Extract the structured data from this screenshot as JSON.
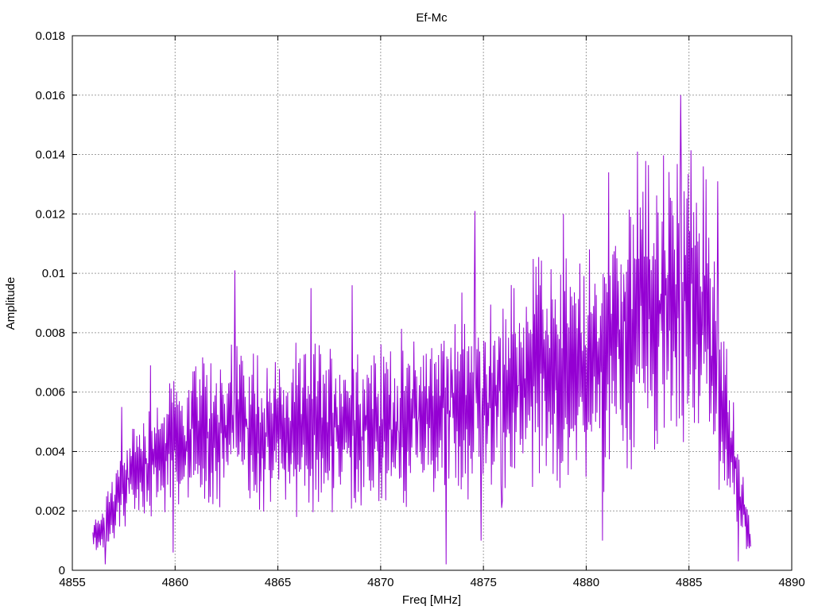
{
  "chart_data": {
    "type": "line",
    "title": "Ef-Mc",
    "xlabel": "Freq [MHz]",
    "ylabel": "Amplitude",
    "xlim": [
      4855,
      4890
    ],
    "ylim": [
      0,
      0.018
    ],
    "x_ticks": [
      "4855",
      "4860",
      "4865",
      "4870",
      "4875",
      "4880",
      "4885",
      "4890"
    ],
    "y_ticks": [
      "0",
      "0.002",
      "0.004",
      "0.006",
      "0.008",
      "0.01",
      "0.012",
      "0.014",
      "0.016",
      "0.018"
    ],
    "grid": true,
    "legend": "none",
    "series": [
      {
        "color": "#9400d3",
        "x_start": 4856.0,
        "x_end": 4888.0,
        "points": 960,
        "envelope": [
          [
            4856.0,
            0.001
          ],
          [
            4857.0,
            0.0022
          ],
          [
            4858.0,
            0.0033
          ],
          [
            4859.0,
            0.0038
          ],
          [
            4860.0,
            0.0042
          ],
          [
            4861.0,
            0.0045
          ],
          [
            4862.0,
            0.0047
          ],
          [
            4863.0,
            0.005
          ],
          [
            4864.0,
            0.0048
          ],
          [
            4865.0,
            0.0046
          ],
          [
            4866.0,
            0.0047
          ],
          [
            4867.0,
            0.005
          ],
          [
            4868.0,
            0.0049
          ],
          [
            4869.0,
            0.0048
          ],
          [
            4870.0,
            0.0049
          ],
          [
            4871.0,
            0.005
          ],
          [
            4872.0,
            0.0052
          ],
          [
            4873.0,
            0.0053
          ],
          [
            4874.0,
            0.0058
          ],
          [
            4875.0,
            0.0057
          ],
          [
            4876.0,
            0.0059
          ],
          [
            4877.0,
            0.0065
          ],
          [
            4878.0,
            0.0068
          ],
          [
            4879.0,
            0.0068
          ],
          [
            4880.0,
            0.0067
          ],
          [
            4881.0,
            0.0075
          ],
          [
            4882.0,
            0.0085
          ],
          [
            4883.0,
            0.0088
          ],
          [
            4884.0,
            0.009
          ],
          [
            4885.0,
            0.0092
          ],
          [
            4886.0,
            0.008
          ],
          [
            4887.0,
            0.0042
          ],
          [
            4887.5,
            0.0025
          ],
          [
            4888.0,
            0.001
          ]
        ],
        "noise": 0.28,
        "peaks": [
          [
            4857.4,
            0.0055
          ],
          [
            4858.8,
            0.0069
          ],
          [
            4862.9,
            0.0101
          ],
          [
            4866.6,
            0.0095
          ],
          [
            4868.6,
            0.0096
          ],
          [
            4874.6,
            0.0121
          ],
          [
            4878.9,
            0.012
          ],
          [
            4881.1,
            0.0134
          ],
          [
            4882.5,
            0.0141
          ],
          [
            4884.6,
            0.016
          ],
          [
            4885.7,
            0.0136
          ],
          [
            4886.4,
            0.0131
          ]
        ],
        "dips": [
          [
            4856.6,
            0.0002
          ],
          [
            4859.9,
            0.0006
          ],
          [
            4873.2,
            0.0002
          ],
          [
            4874.9,
            0.001
          ],
          [
            4875.9,
            0.0021
          ],
          [
            4880.8,
            0.001
          ],
          [
            4887.4,
            0.0003
          ]
        ]
      }
    ]
  }
}
